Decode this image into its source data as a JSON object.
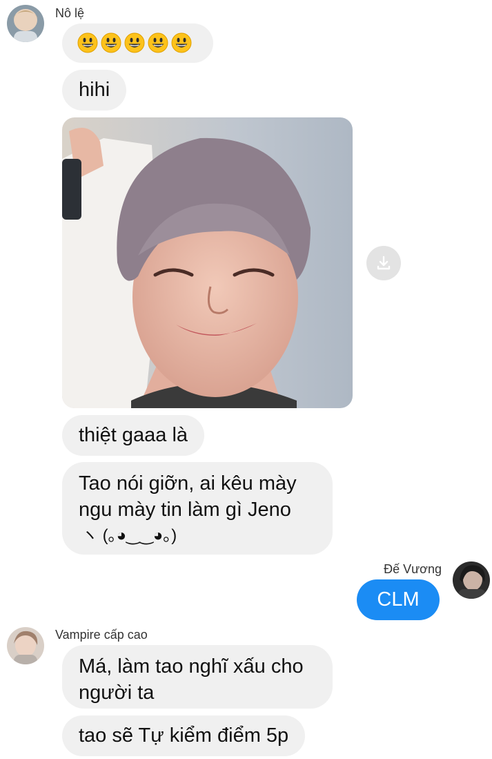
{
  "thread": {
    "sender1": {
      "name": "Nô lệ",
      "emoji_count": 5,
      "emoji_icon": "grinning-face-icon",
      "messages": {
        "hihi": "hihi",
        "thiet_gaaa": "thiệt gaaa là",
        "tao_noi_line1": "Tao nói giỡn, ai kêu mày",
        "tao_noi_line2": "ngu mày tin làm gì Jeno",
        "tao_noi_line3": "ヽ (｡◕‿‿◕｡)"
      },
      "photo_icon": "smiling-person-photo",
      "download_icon": "download-icon"
    },
    "sender2": {
      "name": "Đế Vương",
      "messages": {
        "clm": "CLM"
      }
    },
    "sender3": {
      "name": "Vampire cấp cao",
      "messages": {
        "ma_line1": "Má, làm tao nghĩ xấu cho",
        "ma_line2": "người ta",
        "tao_se": "tao sẽ Tự kiểm điểm 5p"
      }
    }
  },
  "colors": {
    "incoming_bubble": "#f0f0f0",
    "outgoing_bubble": "#1b8cf4",
    "outgoing_text": "#ffffff"
  }
}
